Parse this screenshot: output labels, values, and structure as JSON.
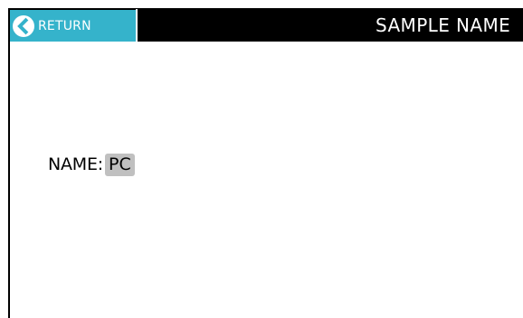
{
  "header": {
    "return_label": "RETURN",
    "return_icon": "chevron-left-circle-icon",
    "title": "SAMPLE NAME"
  },
  "form": {
    "name_label": "NAME:",
    "name_value": "PC"
  },
  "colors": {
    "accent": "#35b3cb",
    "header_background": "#000000",
    "value_background": "#c0c0c0"
  }
}
